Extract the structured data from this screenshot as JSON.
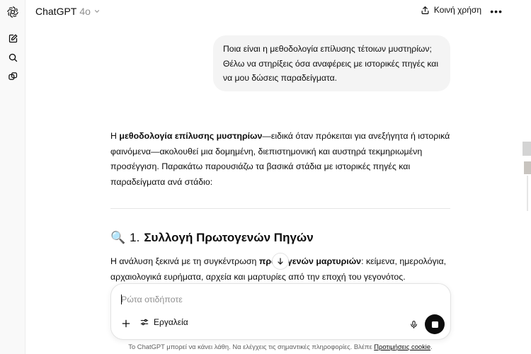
{
  "header": {
    "app_name": "ChatGPT",
    "model_version": "4o",
    "share_label": "Κοινή χρήση",
    "more_label": "•••"
  },
  "user_message": "Ποια είναι η μεθοδολογία επίλυσης τέτοιων μυστηρίων; Θέλω να στηρίξεις όσα αναφέρεις με ιστορικές πηγές και να μου δώσεις παραδείγματα.",
  "answer": {
    "p1_prefix": "Η ",
    "p1_bold": "μεθοδολογία επίλυσης μυστηρίων",
    "p1_rest": "—ειδικά όταν πρόκειται για ανεξήγητα ή ιστορικά φαινόμενα—ακολουθεί μια δομημένη, διεπιστημονική και αυστηρά τεκμηριωμένη προσέγγιση. Παρακάτω παρουσιάζω τα βασικά στάδια με ιστορικές πηγές και παραδείγματα ανά στάδιο:",
    "section1_emoji": "🔍",
    "section1_number": "1.",
    "section1_title": "Συλλογή Πρωτογενών Πηγών",
    "p2_prefix": "Η ανάλυση ξεκινά με τη συγκέντρωση ",
    "p2_bold": "πρωτογενών μαρτυριών",
    "p2_rest": ": κείμενα, ημερολόγια, αρχαιολογικά ευρήματα, αρχεία και μαρτυρίες από την εποχή του γεγονότος."
  },
  "composer": {
    "placeholder": "Ρώτα οτιδήποτε",
    "tools_label": "Εργαλεία"
  },
  "footer": {
    "disclaimer_text": "Το ChatGPT μπορεί να κάνει λάθη. Να ελέγχεις τις σημαντικές πληροφορίες. Βλέπε ",
    "disclaimer_link": "Προτιμήσεις cookie",
    "disclaimer_end": "."
  }
}
